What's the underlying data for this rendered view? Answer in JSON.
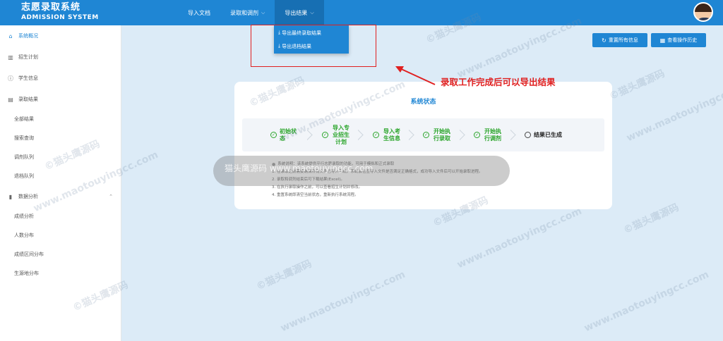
{
  "app": {
    "title_cn": "志愿录取系统",
    "title_en": "ADMISSION SYSTEM"
  },
  "nav": {
    "items": [
      {
        "label": "导入文档",
        "chevron": false
      },
      {
        "label": "录取和调剂",
        "chevron": true
      },
      {
        "label": "导出结果",
        "chevron": true,
        "active": true
      }
    ]
  },
  "dropdown": {
    "items": [
      {
        "label": "导出最终录取结果",
        "icon": "download-icon"
      },
      {
        "label": "导出退档结果",
        "icon": "download-icon"
      }
    ]
  },
  "sidebar": {
    "items": [
      {
        "label": "系统概况",
        "icon": "home-icon",
        "active": true
      },
      {
        "label": "招生计划",
        "icon": "book-icon"
      },
      {
        "label": "学生信息",
        "icon": "info-icon"
      },
      {
        "label": "录取结果",
        "icon": "document-icon"
      },
      {
        "label": "全部结果"
      },
      {
        "label": "搜索查询"
      },
      {
        "label": "调剂队列"
      },
      {
        "label": "退档队列"
      },
      {
        "label": "数据分析",
        "icon": "chart-icon",
        "expanded": true
      },
      {
        "label": "成绩分析"
      },
      {
        "label": "人数分布"
      },
      {
        "label": "成绩区间分布"
      },
      {
        "label": "生源地分布"
      }
    ]
  },
  "actions": {
    "reset_label": "重置所有信息",
    "history_label": "查看操作历史"
  },
  "status_card": {
    "title": "系统状态",
    "steps": [
      {
        "label": "初始状态",
        "done": true
      },
      {
        "label": "导入专业招生计划",
        "done": true
      },
      {
        "label": "导入考生信息",
        "done": true
      },
      {
        "label": "开始执行录取",
        "done": true
      },
      {
        "label": "开始执行调剂",
        "done": true
      },
      {
        "label": "结果已生成",
        "done": false
      }
    ],
    "notes_head": "系统说明：该系统提供平行志愿录取的功能，可用于模拟和正式录取",
    "notes": [
      "1. 在录取之前需要确保所有文件已导入系统。系统会检查导入文件是否满足正确格式，成功导入文件后可以开始录取进程。",
      "2. 录取和调剂结束后可下载结果(Excel)。",
      "3. 在执行录取操作之前，可以查看招生计划并修改。",
      "4. 重置系统即清空当前状态，重新执行系统流程。"
    ]
  },
  "annotation": {
    "text": "录取工作完成后可以导出结果",
    "color": "#e02020"
  },
  "watermark": {
    "cn": "©猫头鹰源码",
    "url": "www.maotouyingcc.com",
    "center": "猫头鹰源码 www.maotouyingcc.com"
  },
  "colors": {
    "primary": "#1f86d4",
    "success": "#2aa52a",
    "annotation": "#e02020"
  }
}
